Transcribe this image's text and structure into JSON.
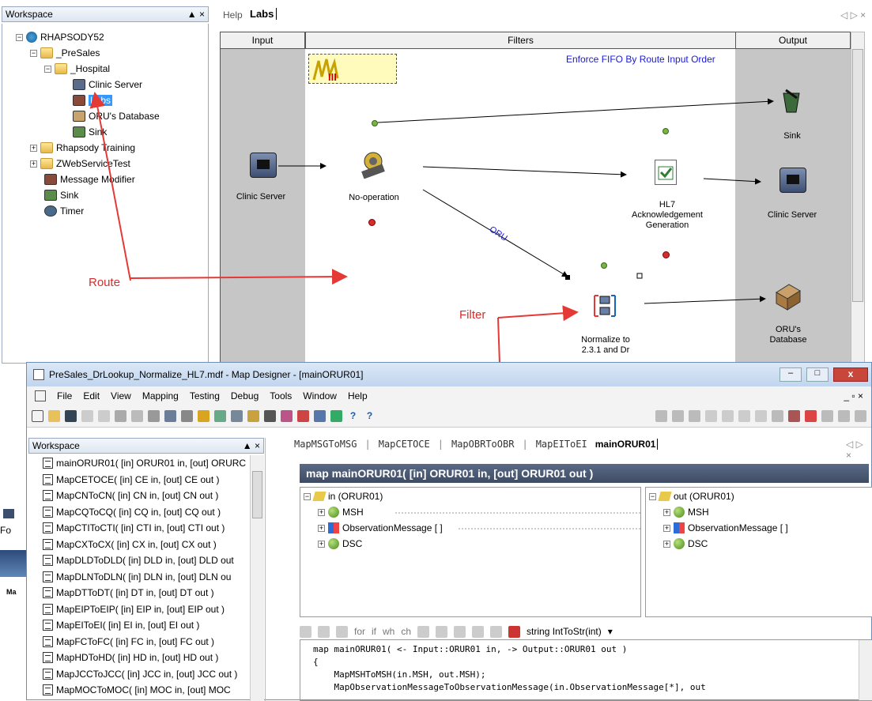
{
  "workspace": {
    "title": "Workspace",
    "close_glyph": "▲ ×"
  },
  "tree": [
    {
      "label": "RHAPSODY52"
    },
    {
      "label": "_PreSales"
    },
    {
      "label": "_Hospital"
    },
    {
      "label": "Clinic Server"
    },
    {
      "label": "Labs"
    },
    {
      "label": "ORU's Database"
    },
    {
      "label": "Sink"
    },
    {
      "label": "Rhapsody Training"
    },
    {
      "label": "ZWebServiceTest"
    },
    {
      "label": "Message Modifier"
    },
    {
      "label": "Sink"
    },
    {
      "label": "Timer"
    }
  ],
  "top_tabs": {
    "help": "Help",
    "labs": "Labs",
    "nav": "◁ ▷ ×"
  },
  "route": {
    "columns": {
      "input": "Input",
      "filters": "Filters",
      "output": "Output"
    },
    "fifo_label": "Enforce FIFO By Route Input Order",
    "nodes": {
      "clinic_in": "Clinic Server",
      "noop": "No-operation",
      "ack": "HL7\nAcknowledgement\nGeneration",
      "clinic_out": "Clinic Server",
      "sink": "Sink",
      "normalize": "Normalize to\n2.3.1 and Dr",
      "oru_db": "ORU's\nDatabase"
    },
    "edge_label": "ORU",
    "annotations": {
      "route": "Route",
      "filter": "Filter"
    }
  },
  "map_designer": {
    "title": "PreSales_DrLookup_Normalize_HL7.mdf - Map Designer - [mainORUR01]",
    "menu": [
      "File",
      "Edit",
      "View",
      "Mapping",
      "Testing",
      "Debug",
      "Tools",
      "Window",
      "Help"
    ],
    "workspace_title": "Workspace",
    "maps": [
      "mainORUR01( [in] ORUR01 in, [out] ORURC",
      "MapCETOCE( [in] CE in, [out] CE out )",
      "MapCNToCN( [in] CN in, [out] CN out )",
      "MapCQToCQ( [in] CQ in, [out] CQ out )",
      "MapCTIToCTI( [in] CTI in, [out] CTI out )",
      "MapCXToCX( [in] CX in, [out] CX out )",
      "MapDLDToDLD( [in] DLD in, [out] DLD out",
      "MapDLNToDLN( [in] DLN in, [out] DLN ou",
      "MapDTToDT( [in] DT in, [out] DT out )",
      "MapEIPToEIP( [in] EIP in, [out] EIP out )",
      "MapEIToEI( [in] EI in, [out] EI out )",
      "MapFCToFC( [in] FC in, [out] FC out )",
      "MapHDToHD( [in] HD in, [out] HD out )",
      "MapJCCToJCC( [in] JCC in, [out] JCC out )",
      "MapMOCToMOC( [in] MOC in, [out] MOC"
    ],
    "tabs": [
      "MapMSGToMSG",
      "MapCETOCE",
      "MapOBRToOBR",
      "MapEIToEI",
      "mainORUR01"
    ],
    "header": "map mainORUR01( [in] ORUR01 in, [out] ORUR01 out )",
    "in_tree": {
      "root": "in (ORUR01)",
      "items": [
        "MSH",
        "ObservationMessage [ ]",
        "DSC"
      ]
    },
    "out_tree": {
      "root": "out (ORUR01)",
      "items": [
        "MSH",
        "ObservationMessage [ ]",
        "DSC"
      ]
    },
    "code_toolbar": {
      "for": "for",
      "if": "if",
      "wh": "wh",
      "ch": "ch",
      "fn": "string IntToStr(int)"
    },
    "code": [
      "map mainORUR01( <- Input::ORUR01 in, -> Output::ORUR01 out )",
      "{",
      "    MapMSHToMSH(in.MSH, out.MSH);",
      "    MapObservationMessageToObservationMessage(in.ObservationMessage[*], out"
    ]
  },
  "partial_left": {
    "fo": "Fo",
    "ma": "Ma"
  }
}
